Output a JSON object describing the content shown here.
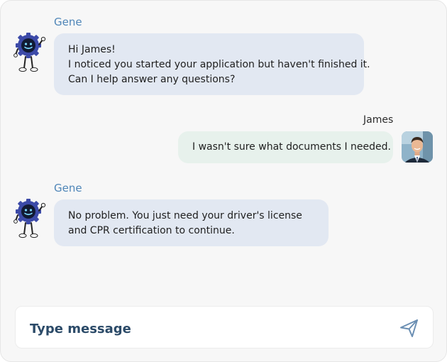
{
  "conversation": {
    "messages": [
      {
        "sender": "Gene",
        "role": "bot",
        "lines": [
          "Hi James!",
          "I noticed you started your application but haven't finished it.",
          "Can I help answer any questions?"
        ]
      },
      {
        "sender": "James",
        "role": "user",
        "lines": [
          "I wasn't sure what documents I needed."
        ]
      },
      {
        "sender": "Gene",
        "role": "bot",
        "lines": [
          "No problem. You just need your driver's license",
          "and CPR certification to continue."
        ]
      }
    ]
  },
  "composer": {
    "placeholder": "Type message",
    "value": ""
  },
  "icons": {
    "bot_avatar": "robot-mascot-icon",
    "user_avatar": "user-photo-avatar",
    "send": "paper-plane-send-icon"
  },
  "colors": {
    "bot_bubble": "#e2e8f2",
    "user_bubble": "#e7f1ec",
    "bot_name": "#4f86b8",
    "accent": "#2b4a68",
    "send_icon": "#6b8fb3"
  }
}
